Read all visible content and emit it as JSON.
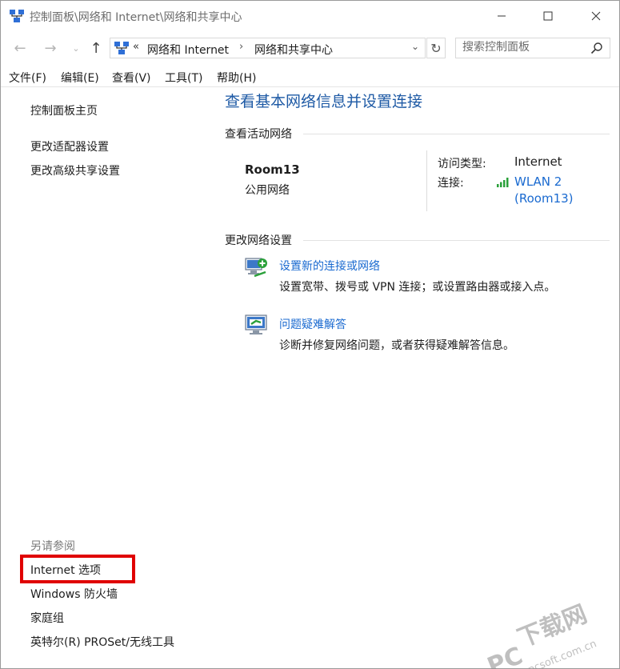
{
  "window": {
    "title": "控制面板\\网络和 Internet\\网络和共享中心",
    "buttons": {
      "minimize": "—",
      "maximize": "☐",
      "close": "✕"
    }
  },
  "address": {
    "chevron": "«",
    "segment1": "网络和 Internet",
    "separator": "›",
    "segment2": "网络和共享中心",
    "dropdown": "⌄",
    "refresh": "↻"
  },
  "nav": {
    "back": "←",
    "forward": "→",
    "recent": "⌄",
    "up": "↑"
  },
  "search": {
    "placeholder": "搜索控制面板"
  },
  "menu": [
    "文件(F)",
    "编辑(E)",
    "查看(V)",
    "工具(T)",
    "帮助(H)"
  ],
  "sidebar": {
    "links": [
      "控制面板主页",
      "更改适配器设置",
      "更改高级共享设置"
    ],
    "see_also_label": "另请参阅",
    "see_also": [
      "Internet 选项",
      "Windows 防火墙",
      "家庭组",
      "英特尔(R) PROSet/无线工具"
    ]
  },
  "main": {
    "title": "查看基本网络信息并设置连接",
    "active_networks_heading": "查看活动网络",
    "network": {
      "name": "Room13",
      "type": "公用网络",
      "access_type_label": "访问类型:",
      "access_type_value": "Internet",
      "connection_label": "连接:",
      "connection_value_line1": "WLAN 2",
      "connection_value_line2": "(Room13)"
    },
    "change_settings_heading": "更改网络设置",
    "tasks": [
      {
        "title": "设置新的连接或网络",
        "description": "设置宽带、拨号或 VPN 连接；或设置路由器或接入点。"
      },
      {
        "title": "问题疑难解答",
        "description": "诊断并修复网络问题，或者获得疑难解答信息。"
      }
    ]
  },
  "watermark": {
    "line1": "下载网",
    "line2": "www.pcsoft.com.cn",
    "brand": "PC"
  },
  "colors": {
    "accent": "#1e5aa5",
    "link": "#1a6ad0",
    "highlight_border": "#e00000",
    "wifi_signal": "#2aa03a"
  }
}
